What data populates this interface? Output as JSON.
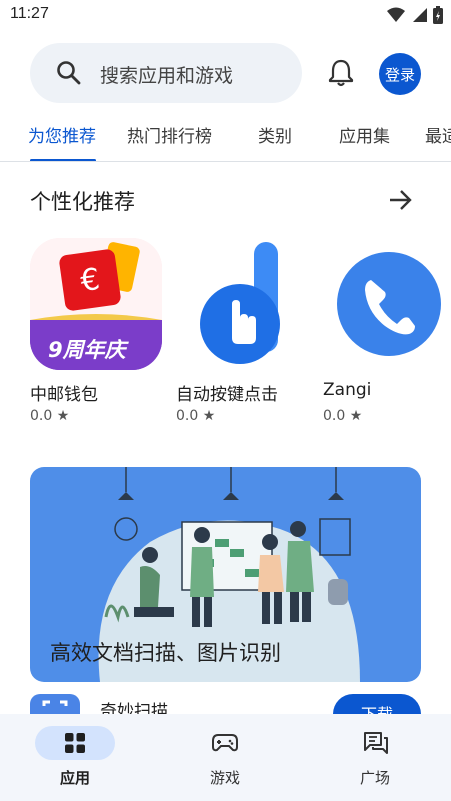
{
  "status_bar": {
    "time": "11:27"
  },
  "search": {
    "placeholder": "搜索应用和游戏"
  },
  "header": {
    "login_label": "登录"
  },
  "tabs": [
    {
      "label": "为您推荐",
      "active": true
    },
    {
      "label": "热门排行榜",
      "active": false
    },
    {
      "label": "类别",
      "active": false
    },
    {
      "label": "应用集",
      "active": false
    },
    {
      "label": "最适",
      "active": false
    }
  ],
  "section": {
    "title": "个性化推荐",
    "apps": [
      {
        "name": "中邮钱包",
        "rating": "0.0 ★",
        "badge_text": "9周年庆"
      },
      {
        "name": "自动按键点击",
        "rating": "0.0 ★"
      },
      {
        "name": "Zangi",
        "rating": "0.0 ★"
      }
    ]
  },
  "banner": {
    "title": "高效文档扫描、图片识别"
  },
  "featured_app": {
    "name": "奇妙扫描",
    "button_label": "下载"
  },
  "bottom_nav": [
    {
      "label": "应用",
      "active": true,
      "icon": "apps-grid-icon"
    },
    {
      "label": "游戏",
      "active": false,
      "icon": "gamepad-icon"
    },
    {
      "label": "广场",
      "active": false,
      "icon": "chat-bubbles-icon"
    }
  ],
  "colors": {
    "accent": "#0b57d0",
    "search_bg": "#eef2f7",
    "banner_bg": "#4f8ee8",
    "nav_bg": "#f3f6fb",
    "nav_pill": "#d3e3fd"
  }
}
